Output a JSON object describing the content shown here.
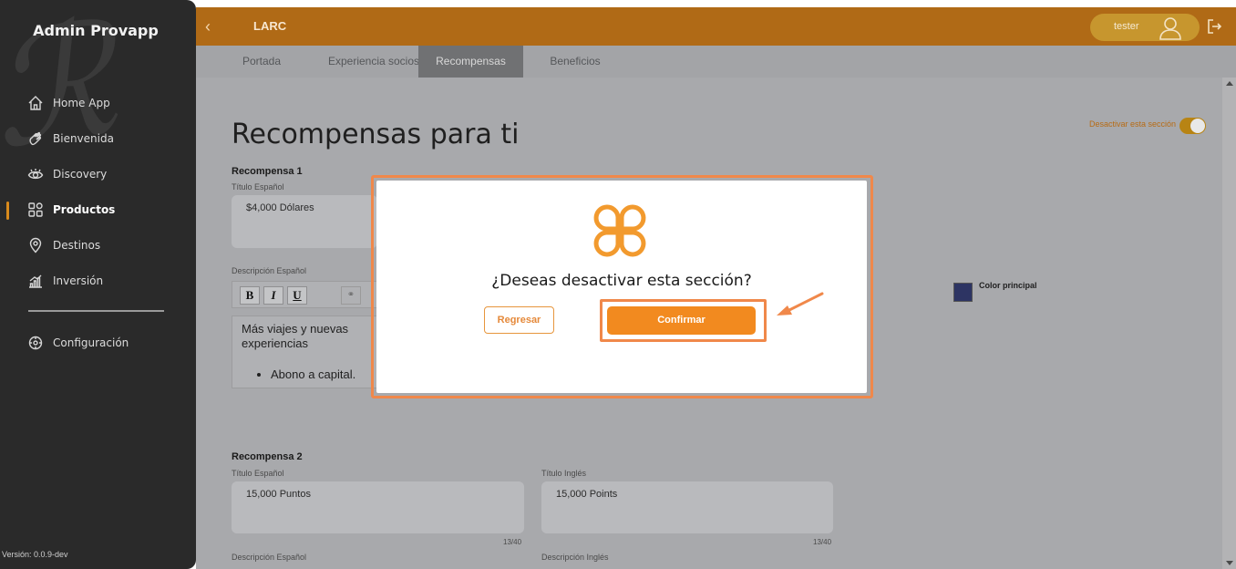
{
  "sidebar": {
    "title": "Admin Provapp",
    "items": [
      {
        "label": "Home App",
        "icon": "home-icon"
      },
      {
        "label": "Bienvenida",
        "icon": "waving-hand-icon"
      },
      {
        "label": "Discovery",
        "icon": "eye-icon"
      },
      {
        "label": "Productos",
        "icon": "grid-icon",
        "active": true
      },
      {
        "label": "Destinos",
        "icon": "location-pin-icon"
      },
      {
        "label": "Inversión",
        "icon": "bar-chart-icon"
      }
    ],
    "config_label": "Configuración",
    "version": "Versión: 0.0.9-dev"
  },
  "topbar": {
    "title": "LARC",
    "user_name": "tester"
  },
  "tabs": [
    {
      "label": "Portada"
    },
    {
      "label": "Experiencia socios"
    },
    {
      "label": "Recompensas",
      "active": true
    },
    {
      "label": "Beneficios"
    }
  ],
  "main": {
    "page_title": "Recompensas para ti",
    "toggle_label": "Desactivar esta sección",
    "reward1": {
      "section_label": "Recompensa 1",
      "title_es_label": "Título Español",
      "title_es_value": "$4,000 Dólares",
      "desc_es_label": "Descripción Español",
      "editor_bold": "B",
      "editor_italic": "I",
      "editor_underline": "U",
      "editor_text": "Más viajes y nuevas experiencias",
      "editor_bullet": "Abono a capital."
    },
    "color_label": "Color principal",
    "reward2": {
      "section_label": "Recompensa 2",
      "title_es_label": "Título Español",
      "title_es_value": "15,000 Puntos",
      "title_es_count": "13/40",
      "title_en_label": "Título Inglés",
      "title_en_value": "15,000 Points",
      "title_en_count": "13/40",
      "desc_es_label": "Descripción Español",
      "desc_en_label": "Descripción Inglés"
    }
  },
  "modal": {
    "question": "¿Deseas desactivar esta sección?",
    "back_label": "Regresar",
    "confirm_label": "Confirmar"
  },
  "colors": {
    "accent": "#f28a1f",
    "topbar": "#b06a16",
    "sidebar": "#2a2a2a",
    "highlight": "#f0884a"
  }
}
